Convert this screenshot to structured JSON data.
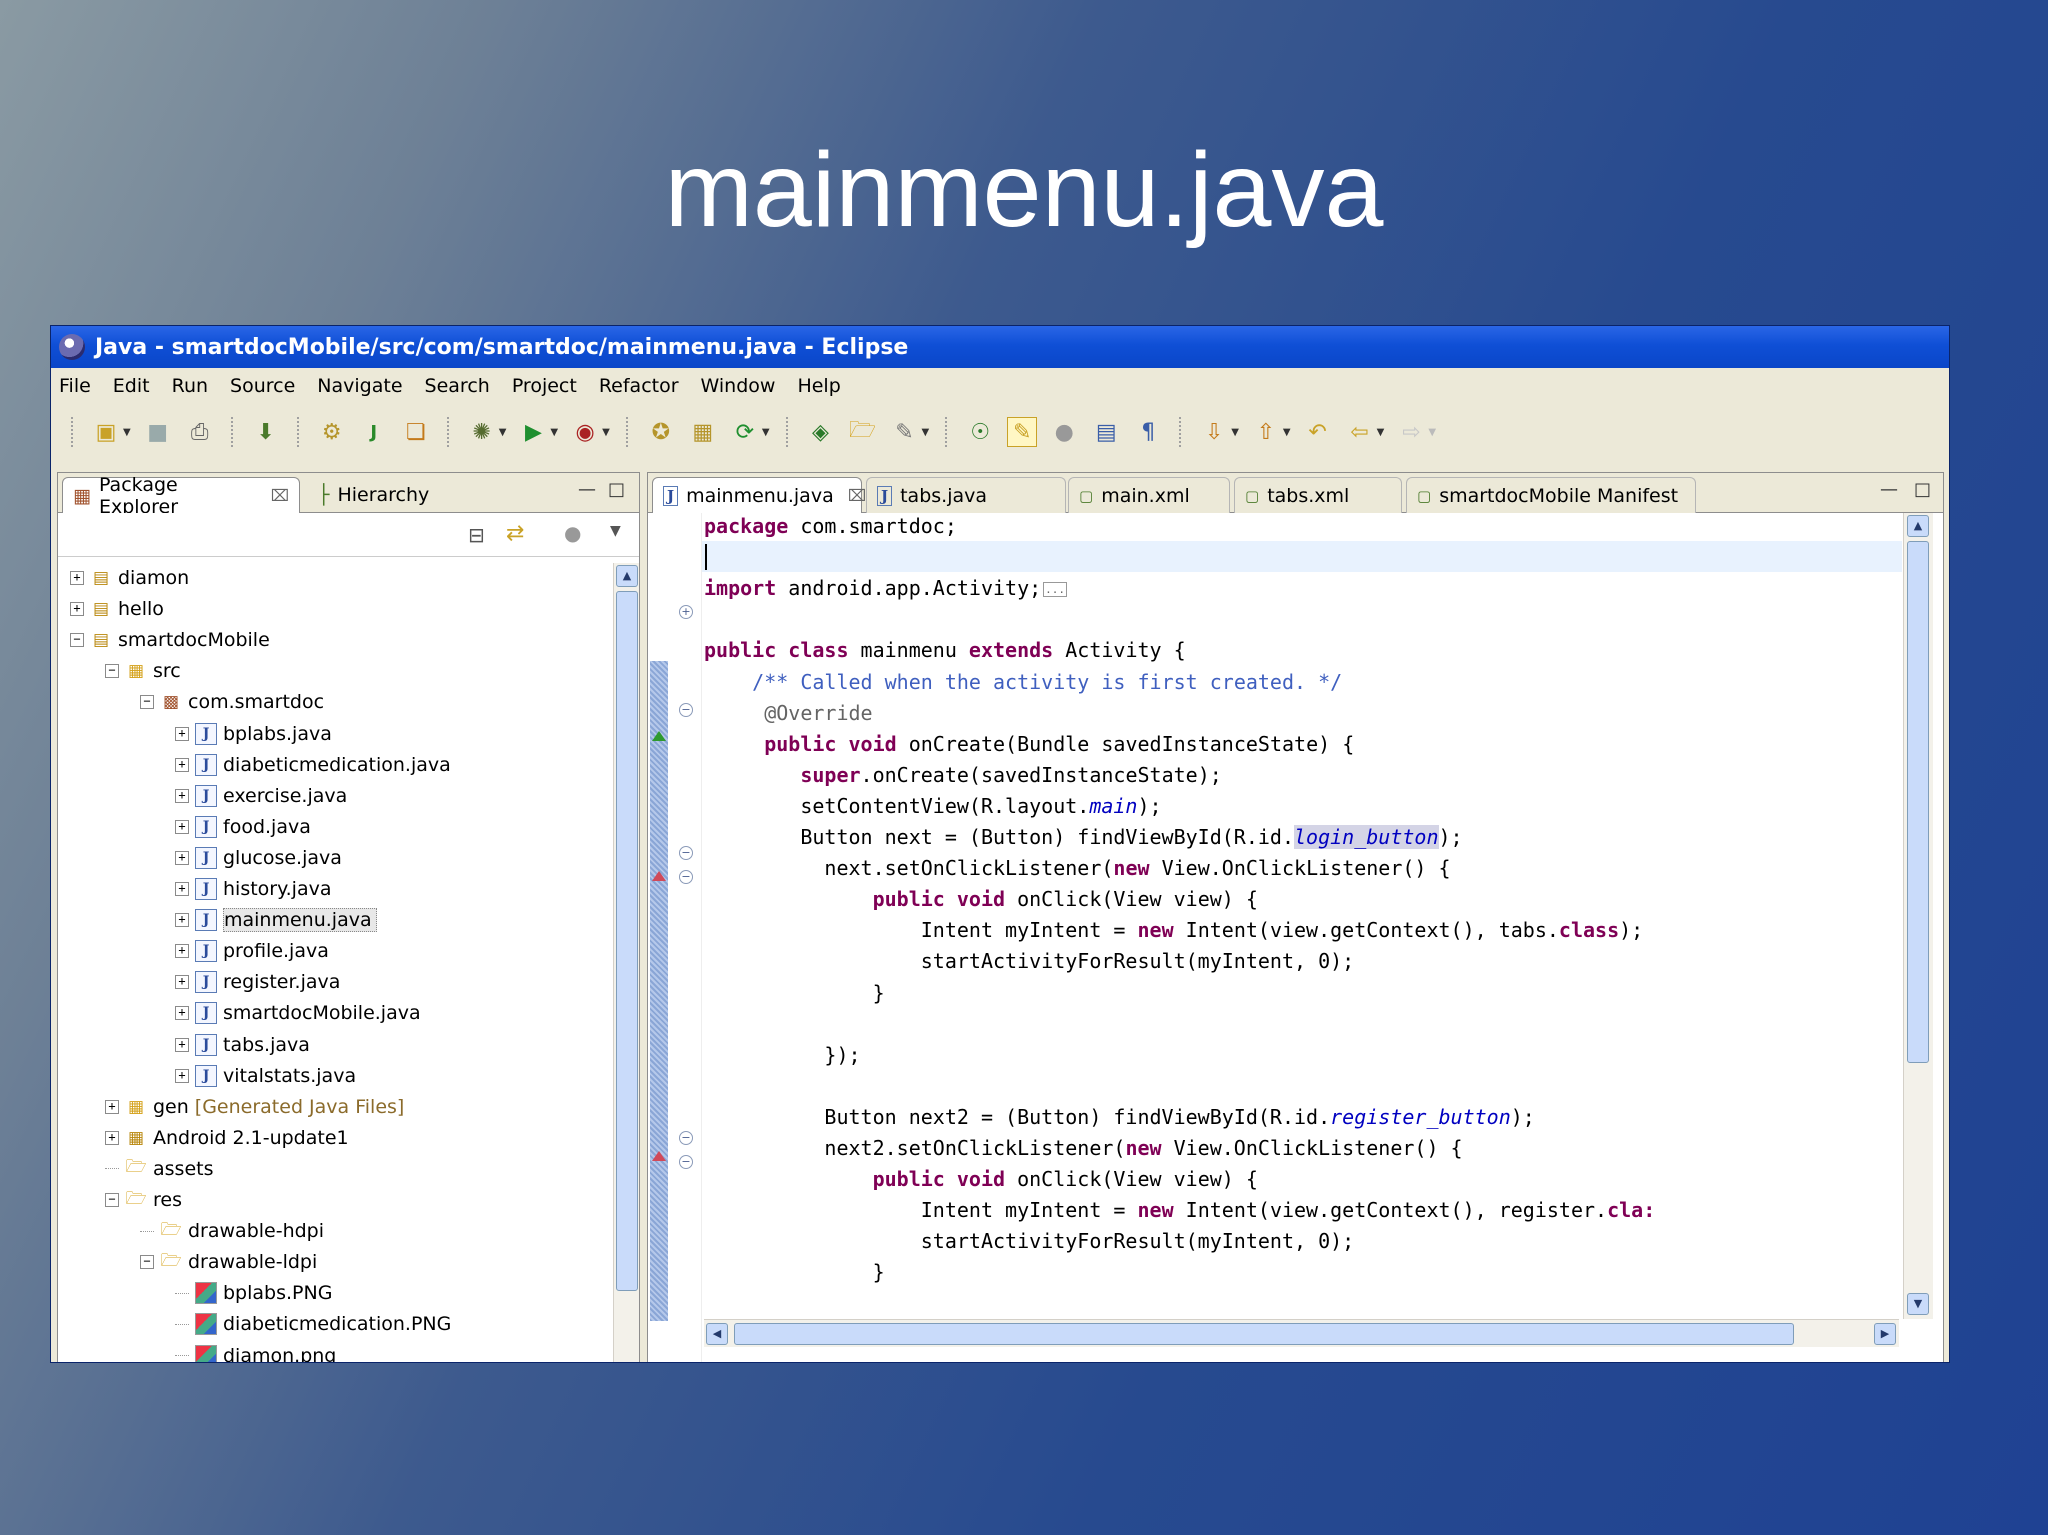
{
  "slide": {
    "title": "mainmenu.java"
  },
  "window": {
    "title": "Java - smartdocMobile/src/com/smartdoc/mainmenu.java - Eclipse"
  },
  "menu": [
    "File",
    "Edit",
    "Run",
    "Source",
    "Navigate",
    "Search",
    "Project",
    "Refactor",
    "Window",
    "Help"
  ],
  "left_panel": {
    "tabs": [
      {
        "label": "Package Explorer",
        "active": true
      },
      {
        "label": "Hierarchy",
        "active": false
      }
    ],
    "tree": [
      {
        "label": "diamon",
        "depth": 0,
        "expander": "+",
        "icon": "project-icon"
      },
      {
        "label": "hello",
        "depth": 0,
        "expander": "+",
        "icon": "project-icon"
      },
      {
        "label": "smartdocMobile",
        "depth": 0,
        "expander": "-",
        "icon": "project-icon"
      },
      {
        "label": "src",
        "depth": 1,
        "expander": "-",
        "icon": "source-folder-icon"
      },
      {
        "label": "com.smartdoc",
        "depth": 2,
        "expander": "-",
        "icon": "package-icon"
      },
      {
        "label": "bplabs.java",
        "depth": 3,
        "expander": "+",
        "icon": "java-file-icon"
      },
      {
        "label": "diabeticmedication.java",
        "depth": 3,
        "expander": "+",
        "icon": "java-file-icon"
      },
      {
        "label": "exercise.java",
        "depth": 3,
        "expander": "+",
        "icon": "java-file-icon"
      },
      {
        "label": "food.java",
        "depth": 3,
        "expander": "+",
        "icon": "java-file-icon"
      },
      {
        "label": "glucose.java",
        "depth": 3,
        "expander": "+",
        "icon": "java-file-icon"
      },
      {
        "label": "history.java",
        "depth": 3,
        "expander": "+",
        "icon": "java-file-icon"
      },
      {
        "label": "mainmenu.java",
        "depth": 3,
        "expander": "+",
        "icon": "java-file-icon",
        "selected": true
      },
      {
        "label": "profile.java",
        "depth": 3,
        "expander": "+",
        "icon": "java-file-icon"
      },
      {
        "label": "register.java",
        "depth": 3,
        "expander": "+",
        "icon": "java-file-icon"
      },
      {
        "label": "smartdocMobile.java",
        "depth": 3,
        "expander": "+",
        "icon": "java-file-icon"
      },
      {
        "label": "tabs.java",
        "depth": 3,
        "expander": "+",
        "icon": "java-file-icon"
      },
      {
        "label": "vitalstats.java",
        "depth": 3,
        "expander": "+",
        "icon": "java-file-icon"
      },
      {
        "label": "gen",
        "suffix": "[Generated Java Files]",
        "depth": 1,
        "expander": "+",
        "icon": "source-folder-icon"
      },
      {
        "label": "Android 2.1-update1",
        "depth": 1,
        "expander": "+",
        "icon": "library-icon"
      },
      {
        "label": "assets",
        "depth": 1,
        "expander": "",
        "icon": "folder-icon"
      },
      {
        "label": "res",
        "depth": 1,
        "expander": "-",
        "icon": "folder-icon"
      },
      {
        "label": "drawable-hdpi",
        "depth": 2,
        "expander": "",
        "icon": "folder-icon"
      },
      {
        "label": "drawable-ldpi",
        "depth": 2,
        "expander": "-",
        "icon": "folder-icon"
      },
      {
        "label": "bplabs.PNG",
        "depth": 3,
        "expander": "",
        "icon": "image-file-icon"
      },
      {
        "label": "diabeticmedication.PNG",
        "depth": 3,
        "expander": "",
        "icon": "image-file-icon"
      },
      {
        "label": "diamon.png",
        "depth": 3,
        "expander": "",
        "icon": "image-file-icon"
      }
    ]
  },
  "editor": {
    "tabs": [
      {
        "label": "mainmenu.java",
        "active": true,
        "closable": true
      },
      {
        "label": "tabs.java"
      },
      {
        "label": "main.xml"
      },
      {
        "label": "tabs.xml"
      },
      {
        "label": "smartdocMobile Manifest"
      }
    ],
    "code": [
      [
        [
          "kw",
          "package"
        ],
        [
          "t",
          " com.smartdoc;"
        ]
      ],
      [],
      [
        [
          "kw",
          "import"
        ],
        [
          "t",
          " android.app.Activity;"
        ],
        [
          "box",
          "..."
        ]
      ],
      [],
      [
        [
          "kw",
          "public class"
        ],
        [
          "t",
          " mainmenu "
        ],
        [
          "kw",
          "extends"
        ],
        [
          "t",
          " Activity {"
        ]
      ],
      [
        [
          "t",
          "    "
        ],
        [
          "cm",
          "/** Called when the activity is first created. */"
        ]
      ],
      [
        [
          "t",
          "     "
        ],
        [
          "an",
          "@Override"
        ]
      ],
      [
        [
          "t",
          "     "
        ],
        [
          "kw",
          "public void"
        ],
        [
          "t",
          " onCreate(Bundle savedInstanceState) {"
        ]
      ],
      [
        [
          "t",
          "        "
        ],
        [
          "kw",
          "super"
        ],
        [
          "t",
          ".onCreate(savedInstanceState);"
        ]
      ],
      [
        [
          "t",
          "        setContentView(R.layout."
        ],
        [
          "fld",
          "main"
        ],
        [
          "t",
          ");"
        ]
      ],
      [
        [
          "t",
          "        Button next = (Button) findViewById(R.id."
        ],
        [
          "fldhl",
          "login_button"
        ],
        [
          "t",
          ");"
        ]
      ],
      [
        [
          "t",
          "          next.setOnClickListener("
        ],
        [
          "kw",
          "new"
        ],
        [
          "t",
          " View.OnClickListener() {"
        ]
      ],
      [
        [
          "t",
          "              "
        ],
        [
          "kw",
          "public void"
        ],
        [
          "t",
          " onClick(View view) {"
        ]
      ],
      [
        [
          "t",
          "                  Intent myIntent = "
        ],
        [
          "kw",
          "new"
        ],
        [
          "t",
          " Intent(view.getContext(), tabs."
        ],
        [
          "kw",
          "class"
        ],
        [
          "t",
          ");"
        ]
      ],
      [
        [
          "t",
          "                  startActivityForResult(myIntent, 0);"
        ]
      ],
      [
        [
          "t",
          "              }"
        ]
      ],
      [],
      [
        [
          "t",
          "          });"
        ]
      ],
      [],
      [
        [
          "t",
          "          Button next2 = (Button) findViewById(R.id."
        ],
        [
          "fld",
          "register_button"
        ],
        [
          "t",
          ");"
        ]
      ],
      [
        [
          "t",
          "          next2.setOnClickListener("
        ],
        [
          "kw",
          "new"
        ],
        [
          "t",
          " View.OnClickListener() {"
        ]
      ],
      [
        [
          "t",
          "              "
        ],
        [
          "kw",
          "public void"
        ],
        [
          "t",
          " onClick(View view) {"
        ]
      ],
      [
        [
          "t",
          "                  Intent myIntent = "
        ],
        [
          "kw",
          "new"
        ],
        [
          "t",
          " Intent(view.getContext(), register."
        ],
        [
          "kw",
          "cla:"
        ]
      ],
      [
        [
          "t",
          "                  startActivityForResult(myIntent, 0);"
        ]
      ],
      [
        [
          "t",
          "              }"
        ]
      ]
    ]
  }
}
